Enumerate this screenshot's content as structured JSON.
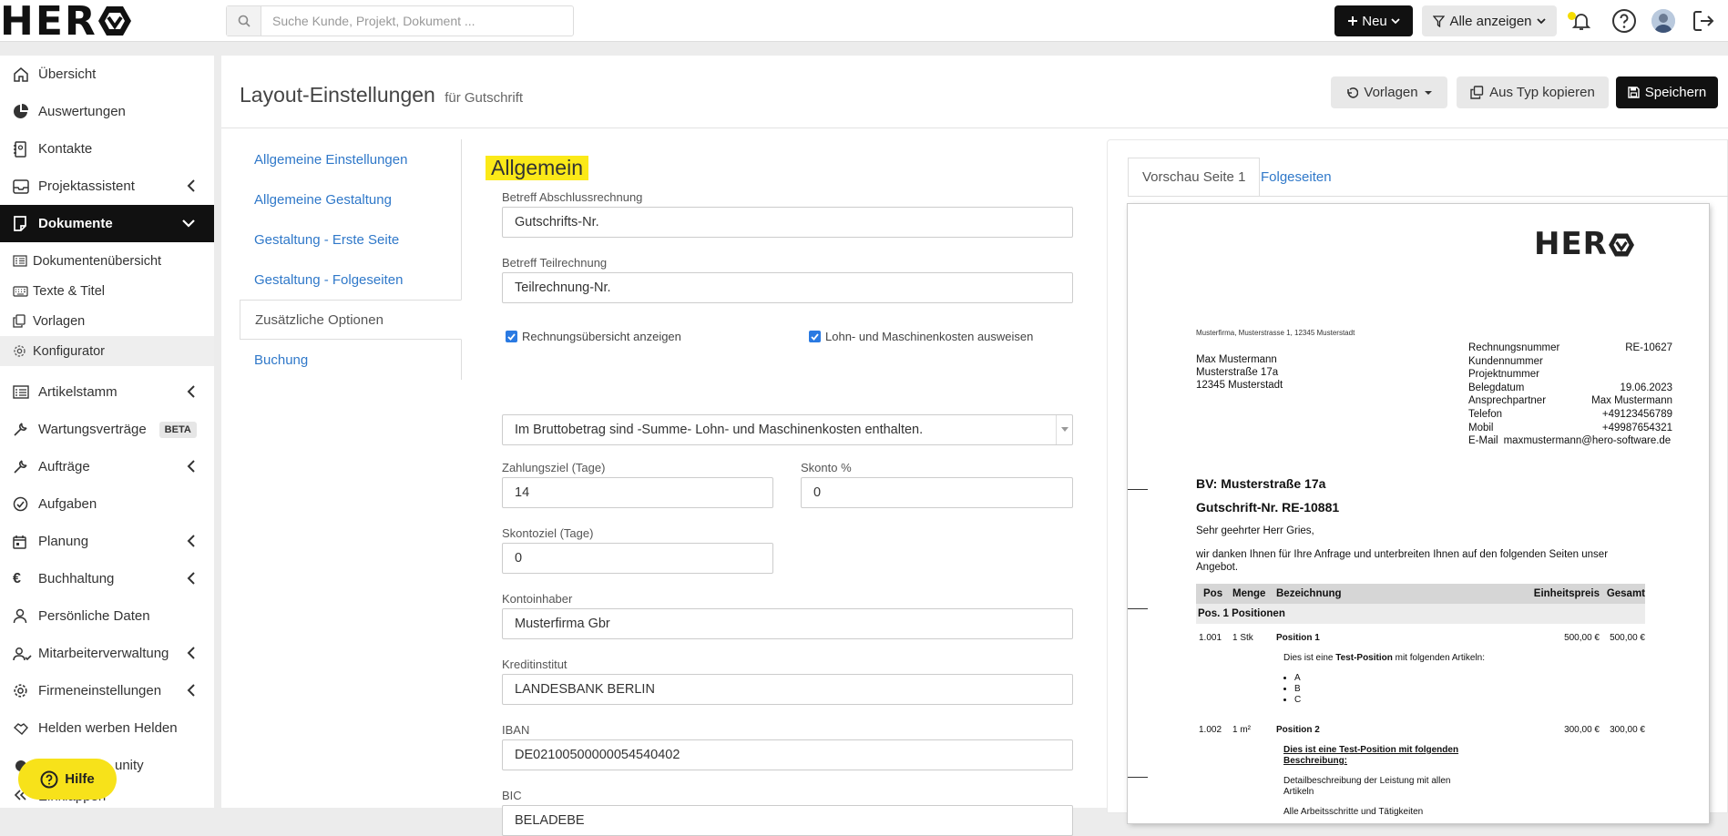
{
  "header": {
    "logo_text": "HER",
    "search_placeholder": "Suche Kunde, Projekt, Dokument ...",
    "new_label": "Neu",
    "filter_label": "Alle anzeigen",
    "accent_color": "#f5dc00"
  },
  "sidebar": {
    "items": [
      {
        "label": "Übersicht",
        "icon": "home-icon"
      },
      {
        "label": "Auswertungen",
        "icon": "pie-chart-icon"
      },
      {
        "label": "Kontakte",
        "icon": "address-book-icon"
      },
      {
        "label": "Projektassistent",
        "icon": "inbox-icon"
      },
      {
        "label": "Dokumente",
        "icon": "document-icon"
      }
    ],
    "sub_items": [
      {
        "label": "Dokumentenübersicht",
        "icon": "list-icon"
      },
      {
        "label": "Texte & Titel",
        "icon": "keyboard-icon"
      },
      {
        "label": "Vorlagen",
        "icon": "copy-icon"
      },
      {
        "label": "Konfigurator",
        "icon": "gear-icon"
      }
    ],
    "items2": [
      {
        "label": "Artikelstamm",
        "icon": "list-icon"
      },
      {
        "label": "Wartungsverträge",
        "icon": "wrench-icon",
        "badge": "BETA"
      },
      {
        "label": "Aufträge",
        "icon": "wrench-icon"
      },
      {
        "label": "Aufgaben",
        "icon": "check-circle-icon"
      },
      {
        "label": "Planung",
        "icon": "calendar-icon"
      },
      {
        "label": "Buchhaltung",
        "icon": "euro-icon"
      },
      {
        "label": "Persönliche Daten",
        "icon": "user-icon"
      },
      {
        "label": "Mitarbeiterverwaltung",
        "icon": "users-icon"
      },
      {
        "label": "Firmeneinstellungen",
        "icon": "gear-icon"
      },
      {
        "label": "Helden werben Helden",
        "icon": "handshake-icon"
      },
      {
        "label": "unity",
        "icon": "community-icon"
      },
      {
        "label": "Einklappen",
        "icon": "collapse-icon"
      }
    ],
    "help_label": "Hilfe"
  },
  "page": {
    "title": "Layout-Einstellungen",
    "subtitle": "für Gutschrift",
    "templates_label": "Vorlagen",
    "copy_label": "Aus Typ kopieren",
    "save_label": "Speichern"
  },
  "settings_tabs": [
    "Allgemeine Einstellungen",
    "Allgemeine Gestaltung",
    "Gestaltung - Erste Seite",
    "Gestaltung - Folgeseiten",
    "Zusätzliche Optionen",
    "Buchung"
  ],
  "form": {
    "section_title": "Allgemein",
    "betreff_abschluss_label": "Betreff Abschlussrechnung",
    "betreff_abschluss_value": "Gutschrifts-Nr.",
    "betreff_teil_label": "Betreff Teilrechnung",
    "betreff_teil_value": "Teilrechnung-Nr.",
    "checkbox_uebersicht": "Rechnungsübersicht anzeigen",
    "checkbox_lohn": "Lohn- und Maschinenkosten ausweisen",
    "brutto_select": "Im Bruttobetrag sind -Summe- Lohn- und Maschinenkosten enthalten.",
    "zahlungsziel_label": "Zahlungsziel (Tage)",
    "zahlungsziel_value": "14",
    "skonto_label": "Skonto %",
    "skonto_value": "0",
    "skontoziel_label": "Skontoziel (Tage)",
    "skontoziel_value": "0",
    "kontoinhaber_label": "Kontoinhaber",
    "kontoinhaber_value": "Musterfirma Gbr",
    "kreditinstitut_label": "Kreditinstitut",
    "kreditinstitut_value": "LANDESBANK BERLIN",
    "iban_label": "IBAN",
    "iban_value": "DE02100500000054540402",
    "bic_label": "BIC",
    "bic_value": "BELADEBE"
  },
  "preview": {
    "tab_first": "Vorschau Seite 1",
    "tab_next": "Folgeseiten",
    "logo_text": "HER",
    "sender_line": "Musterfirma, Musterstrasse 1, 12345 Musterstadt",
    "address": [
      "Max Mustermann",
      "Musterstraße 17a",
      "12345 Musterstadt"
    ],
    "meta": [
      {
        "label": "Rechnungsnummer",
        "value": "RE-10627"
      },
      {
        "label": "Kundennummer",
        "value": ""
      },
      {
        "label": "Projektnummer",
        "value": ""
      },
      {
        "label": "Belegdatum",
        "value": "19.06.2023"
      },
      {
        "label": "Ansprechpartner",
        "value": "Max Mustermann"
      },
      {
        "label": "Telefon",
        "value": "+49123456789"
      },
      {
        "label": "Mobil",
        "value": "+49987654321"
      },
      {
        "label": "E-Mail",
        "value": "maxmustermann@hero-software.de"
      }
    ],
    "bv": "BV: Musterstraße 17a",
    "gutschrift_title": "Gutschrift-Nr. RE-10881",
    "greeting": "Sehr geehrter Herr Gries,",
    "intro": "wir danken Ihnen für Ihre Anfrage und unterbreiten Ihnen auf den folgenden Seiten unser Angebot.",
    "table": {
      "headers": [
        "Pos",
        "Menge",
        "Bezeichnung",
        "Einheitspreis",
        "Gesamt"
      ],
      "group": "Pos. 1  Positionen",
      "row1": {
        "pos": "1.001",
        "menge": "1 Stk",
        "bez": "Position 1",
        "ep": "500,00 €",
        "ges": "500,00 €"
      },
      "row1_desc_pre": "Dies ist eine ",
      "row1_desc_bold": "Test-Position",
      "row1_desc_post": " mit folgenden Artikeln:",
      "row1_list": [
        "A",
        "B",
        "C"
      ],
      "row2": {
        "pos": "1.002",
        "menge": "1 m²",
        "bez": "Position 2",
        "ep": "300,00 €",
        "ges": "300,00 €"
      },
      "row2_desc_title": "Dies ist eine Test-Position mit folgenden Beschreibung:",
      "row2_line1": "Detailbeschreibung der Leistung mit allen Artikeln",
      "row2_line2": "Alle Arbeitsschritte und Tätigkeiten"
    }
  }
}
